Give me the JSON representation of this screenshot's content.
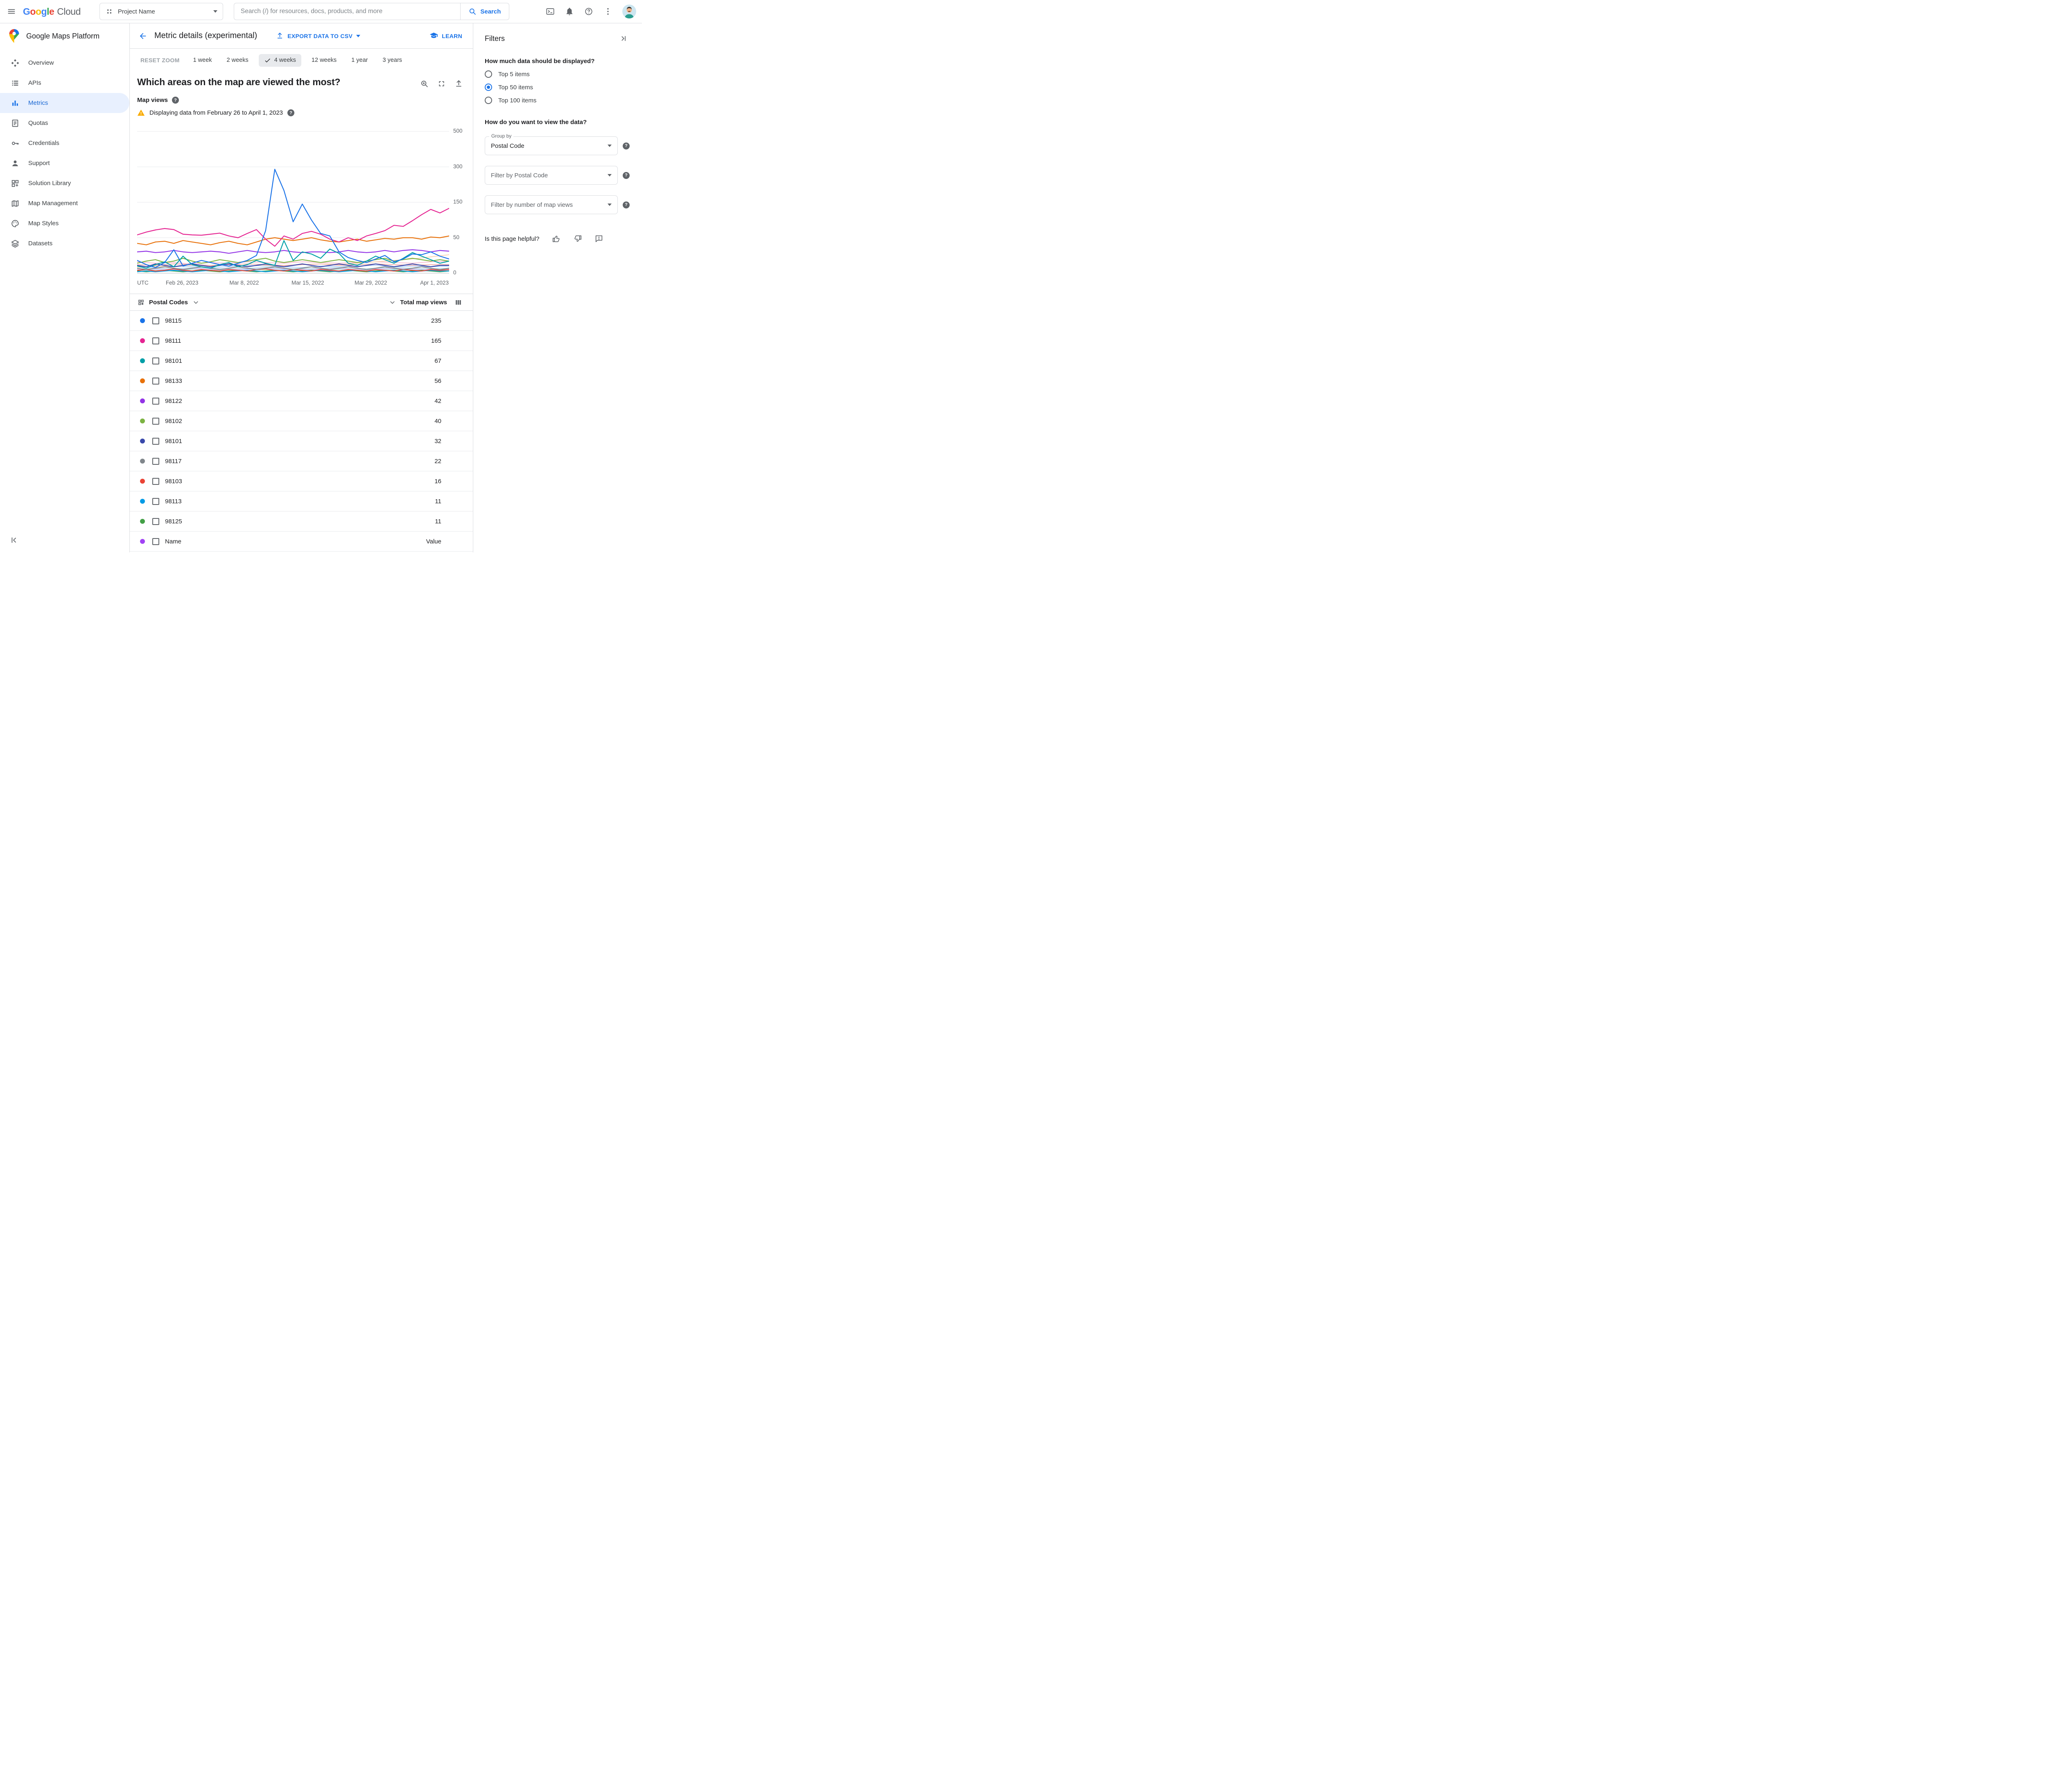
{
  "topbar": {
    "product_google": "Google",
    "product_cloud": "Cloud",
    "project_name": "Project Name",
    "search_placeholder": "Search (/) for resources, docs, products, and more",
    "search_button": "Search"
  },
  "sidebar": {
    "title": "Google Maps Platform",
    "items": [
      {
        "label": "Overview",
        "icon": "overview-icon",
        "selected": false
      },
      {
        "label": "APIs",
        "icon": "apis-icon",
        "selected": false
      },
      {
        "label": "Metrics",
        "icon": "metrics-icon",
        "selected": true
      },
      {
        "label": "Quotas",
        "icon": "quotas-icon",
        "selected": false
      },
      {
        "label": "Credentials",
        "icon": "credentials-icon",
        "selected": false
      },
      {
        "label": "Support",
        "icon": "support-icon",
        "selected": false
      },
      {
        "label": "Solution Library",
        "icon": "solution-library-icon",
        "selected": false
      },
      {
        "label": "Map Management",
        "icon": "map-management-icon",
        "selected": false
      },
      {
        "label": "Map Styles",
        "icon": "map-styles-icon",
        "selected": false
      },
      {
        "label": "Datasets",
        "icon": "datasets-icon",
        "selected": false
      }
    ]
  },
  "header": {
    "title": "Metric details (experimental)",
    "export_button": "EXPORT DATA TO CSV",
    "learn_link": "LEARN"
  },
  "time_controls": {
    "reset_zoom": "RESET ZOOM",
    "ranges": [
      {
        "label": "1 week",
        "selected": false
      },
      {
        "label": "2 weeks",
        "selected": false
      },
      {
        "label": "4 weeks",
        "selected": true
      },
      {
        "label": "12 weeks",
        "selected": false
      },
      {
        "label": "1 year",
        "selected": false
      },
      {
        "label": "3 years",
        "selected": false
      }
    ]
  },
  "chart_section": {
    "question": "Which areas on the map are viewed the most?",
    "metric_label": "Map views",
    "warning_text": "Displaying data from February 26 to April 1, 2023"
  },
  "chart_data": {
    "type": "line",
    "title": "Which areas on the map are viewed the most?",
    "ylabel": "Map views",
    "timezone_label": "UTC",
    "x_tick_labels": [
      "Feb 26, 2023",
      "Mar 8, 2022",
      "Mar 15, 2022",
      "Mar 29, 2022",
      "Apr 1, 2023"
    ],
    "y_ticks": [
      0,
      50,
      150,
      300,
      500
    ],
    "y_scale": "power-like, ticks 0/50/150/300/500 equally spaced",
    "grid": true,
    "legend_position": "table-below",
    "series": [
      {
        "name": "98115",
        "color": "#1a73e8",
        "values": [
          18,
          12,
          8,
          15,
          33,
          10,
          14,
          18,
          15,
          12,
          10,
          14,
          18,
          25,
          70,
          290,
          200,
          95,
          145,
          100,
          62,
          55,
          30,
          22,
          18,
          15,
          20,
          25,
          16,
          20,
          27,
          26,
          30,
          24,
          20
        ]
      },
      {
        "name": "98111",
        "color": "#e52592",
        "values": [
          58,
          66,
          72,
          76,
          73,
          60,
          58,
          57,
          60,
          63,
          55,
          50,
          62,
          73,
          48,
          38,
          55,
          48,
          62,
          68,
          60,
          48,
          44,
          50,
          46,
          55,
          62,
          70,
          85,
          82,
          98,
          115,
          130,
          120,
          133
        ]
      },
      {
        "name": "98101",
        "color": "#009fa7",
        "values": [
          10,
          7,
          12,
          16,
          9,
          24,
          12,
          9,
          7,
          12,
          15,
          9,
          12,
          18,
          14,
          11,
          46,
          18,
          30,
          27,
          21,
          34,
          28,
          14,
          11,
          17,
          24,
          19,
          14,
          21,
          29,
          24,
          19,
          14,
          17
        ]
      },
      {
        "name": "98133",
        "color": "#e8710a",
        "values": [
          42,
          40,
          44,
          45,
          42,
          46,
          44,
          42,
          40,
          43,
          45,
          42,
          40,
          44,
          48,
          50,
          48,
          46,
          48,
          50,
          47,
          45,
          44,
          46,
          48,
          45,
          47,
          49,
          48,
          50,
          50,
          48,
          52,
          50,
          55
        ]
      },
      {
        "name": "98122",
        "color": "#9334e6",
        "values": [
          30,
          31,
          29,
          30,
          32,
          30,
          29,
          30,
          31,
          30,
          28,
          30,
          32,
          30,
          29,
          30,
          32,
          30,
          29,
          30,
          30,
          29,
          30,
          32,
          30,
          29,
          30,
          32,
          30,
          32,
          33,
          32,
          30,
          32,
          31
        ]
      },
      {
        "name": "98102",
        "color": "#7cb342",
        "values": [
          14,
          17,
          19,
          15,
          17,
          21,
          17,
          14,
          16,
          19,
          17,
          15,
          17,
          19,
          21,
          17,
          15,
          17,
          19,
          17,
          15,
          17,
          19,
          17,
          15,
          17,
          19,
          21,
          17,
          19,
          21,
          19,
          17,
          19,
          17
        ]
      },
      {
        "name": "98101",
        "color": "#3949ab",
        "values": [
          11,
          9,
          13,
          11,
          9,
          11,
          13,
          11,
          9,
          11,
          13,
          11,
          9,
          11,
          13,
          11,
          9,
          11,
          13,
          11,
          9,
          11,
          13,
          11,
          9,
          11,
          13,
          11,
          9,
          11,
          13,
          11,
          9,
          11,
          11
        ]
      },
      {
        "name": "98117",
        "color": "#80868b",
        "values": [
          7,
          5,
          7,
          9,
          7,
          5,
          7,
          9,
          7,
          5,
          7,
          9,
          7,
          5,
          7,
          9,
          7,
          5,
          7,
          9,
          7,
          5,
          7,
          9,
          7,
          5,
          7,
          9,
          7,
          5,
          7,
          9,
          7,
          5,
          7
        ]
      },
      {
        "name": "98103",
        "color": "#ea4335",
        "values": [
          4,
          5,
          3,
          4,
          6,
          4,
          3,
          5,
          4,
          3,
          5,
          4,
          3,
          5,
          6,
          4,
          3,
          5,
          4,
          3,
          5,
          4,
          3,
          5,
          4,
          3,
          5,
          4,
          3,
          5,
          4,
          3,
          5,
          4,
          5
        ]
      },
      {
        "name": "98113",
        "color": "#039be5",
        "values": [
          2,
          3,
          2,
          3,
          4,
          3,
          2,
          3,
          4,
          3,
          2,
          3,
          4,
          3,
          2,
          3,
          4,
          3,
          2,
          3,
          4,
          3,
          2,
          3,
          4,
          3,
          2,
          3,
          4,
          3,
          2,
          3,
          4,
          3,
          3
        ]
      },
      {
        "name": "98125",
        "color": "#43a047",
        "values": [
          3,
          2,
          3,
          4,
          3,
          2,
          3,
          4,
          3,
          2,
          3,
          4,
          3,
          2,
          3,
          4,
          3,
          2,
          3,
          4,
          3,
          2,
          3,
          4,
          3,
          2,
          3,
          4,
          3,
          2,
          3,
          4,
          3,
          2,
          3
        ]
      }
    ],
    "background_series": [
      {
        "name": "",
        "color": "#f8bbd0",
        "values": [
          16,
          14,
          15,
          13,
          15,
          14,
          16,
          15,
          14,
          16,
          15,
          14,
          15,
          16,
          15,
          14,
          16,
          17
        ]
      },
      {
        "name": "",
        "color": "#fad2b0",
        "values": [
          8,
          10,
          9,
          11,
          10,
          12,
          10,
          11,
          10,
          12,
          13,
          12,
          14,
          16,
          18,
          20,
          23,
          26
        ]
      },
      {
        "name": "",
        "color": "#aecbfa",
        "values": [
          10,
          8,
          9,
          10,
          8,
          9,
          11,
          10,
          9,
          8,
          10,
          9,
          10,
          11,
          9,
          10,
          9,
          10
        ]
      },
      {
        "name": "",
        "color": "#b7e1e4",
        "values": [
          6,
          7,
          6,
          8,
          7,
          6,
          7,
          8,
          7,
          6,
          7,
          8,
          6,
          7,
          8,
          7,
          6,
          7
        ]
      },
      {
        "name": "",
        "color": "#d9c2f0",
        "values": [
          5,
          6,
          5,
          7,
          6,
          5,
          6,
          7,
          6,
          5,
          6,
          7,
          5,
          6,
          7,
          6,
          5,
          6
        ]
      },
      {
        "name": "",
        "color": "#f3b0ab",
        "values": [
          12,
          11,
          13,
          12,
          11,
          12,
          13,
          12,
          11,
          12,
          13,
          11,
          12,
          13,
          12,
          11,
          12,
          12
        ]
      },
      {
        "name": "",
        "color": "#c6dafc",
        "values": [
          4,
          5,
          4,
          6,
          5,
          4,
          5,
          6,
          5,
          4,
          5,
          6,
          4,
          5,
          6,
          5,
          4,
          5
        ]
      },
      {
        "name": "",
        "color": "#cdeccd",
        "values": [
          3,
          4,
          3,
          5,
          4,
          3,
          4,
          5,
          4,
          3,
          4,
          5,
          3,
          4,
          5,
          4,
          3,
          4
        ]
      }
    ]
  },
  "table": {
    "group_column": "Postal Codes",
    "sort_column": "Total map views",
    "rows": [
      {
        "code": "98115",
        "value": "235",
        "color": "#1a73e8"
      },
      {
        "code": "98111",
        "value": "165",
        "color": "#e52592"
      },
      {
        "code": "98101",
        "value": "67",
        "color": "#009fa7"
      },
      {
        "code": "98133",
        "value": "56",
        "color": "#e8710a"
      },
      {
        "code": "98122",
        "value": "42",
        "color": "#9334e6"
      },
      {
        "code": "98102",
        "value": "40",
        "color": "#7cb342"
      },
      {
        "code": "98101",
        "value": "32",
        "color": "#3949ab"
      },
      {
        "code": "98117",
        "value": "22",
        "color": "#80868b"
      },
      {
        "code": "98103",
        "value": "16",
        "color": "#ea4335"
      },
      {
        "code": "98113",
        "value": "11",
        "color": "#039be5"
      },
      {
        "code": "98125",
        "value": "11",
        "color": "#43a047"
      },
      {
        "code": "Name",
        "value": "Value",
        "color": "#a142f4"
      }
    ]
  },
  "filters": {
    "title": "Filters",
    "data_amount_question": "How much data should be displayed?",
    "options": [
      {
        "label": "Top 5 items",
        "selected": false
      },
      {
        "label": "Top 50 items",
        "selected": true
      },
      {
        "label": "Top 100 items",
        "selected": false
      }
    ],
    "view_question": "How do you want to view the data?",
    "group_by_label": "Group by",
    "group_by_value": "Postal Code",
    "postal_filter_placeholder": "Filter by Postal Code",
    "views_filter_placeholder": "Filter by number of map views",
    "helpful_question": "Is this page helpful?"
  },
  "colors": {
    "accent": "#1a73e8",
    "selected_nav_bg": "#e8f0fe",
    "selected_nav_text": "#1967d2",
    "warning": "#f9ab00"
  }
}
